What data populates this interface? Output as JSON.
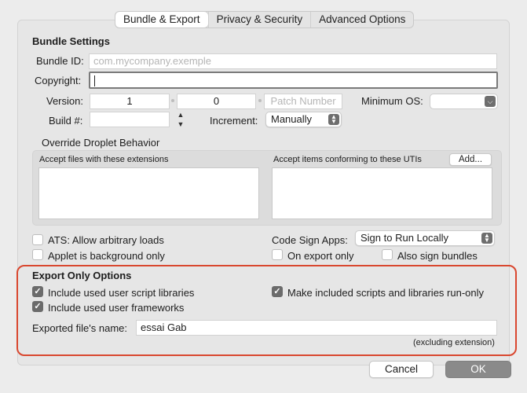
{
  "tabs": [
    {
      "label": "Bundle & Export",
      "active": true
    },
    {
      "label": "Privacy & Security",
      "active": false
    },
    {
      "label": "Advanced Options",
      "active": false
    }
  ],
  "bundle_settings": {
    "heading": "Bundle Settings",
    "bundle_id_label": "Bundle ID:",
    "bundle_id_placeholder": "com.mycompany.exemple",
    "copyright_label": "Copyright:",
    "copyright_value": "",
    "version_label": "Version:",
    "version_major": "1",
    "version_minor": "0",
    "patch_placeholder": "Patch Number",
    "minimum_os_label": "Minimum OS:",
    "minimum_os_value": "",
    "build_label": "Build #:",
    "build_value": "",
    "increment_label": "Increment:",
    "increment_value": "Manually"
  },
  "droplet": {
    "heading": "Override Droplet Behavior",
    "extensions_label": "Accept files with these extensions",
    "utis_label": "Accept items conforming to these UTIs",
    "add_button": "Add..."
  },
  "options": {
    "ats_label": "ATS: Allow arbitrary loads",
    "ats_checked": false,
    "applet_bg_label": "Applet is background only",
    "applet_bg_checked": false,
    "code_sign_label": "Code Sign Apps:",
    "code_sign_value": "Sign to Run Locally",
    "on_export_label": "On export only",
    "on_export_checked": false,
    "also_sign_label": "Also sign bundles",
    "also_sign_checked": false
  },
  "export_only": {
    "heading": "Export Only Options",
    "include_libraries_label": "Include used user script libraries",
    "include_libraries_checked": true,
    "make_run_only_label": "Make included scripts and libraries run-only",
    "make_run_only_checked": true,
    "include_frameworks_label": "Include used user frameworks",
    "include_frameworks_checked": true,
    "exported_name_label": "Exported file's name:",
    "exported_name_value": "essai Gab",
    "excluding_note": "(excluding extension)"
  },
  "footer": {
    "cancel_label": "Cancel",
    "ok_label": "OK"
  },
  "colors": {
    "highlight": "#d9472f",
    "ok_button": "#8a8a8a"
  }
}
